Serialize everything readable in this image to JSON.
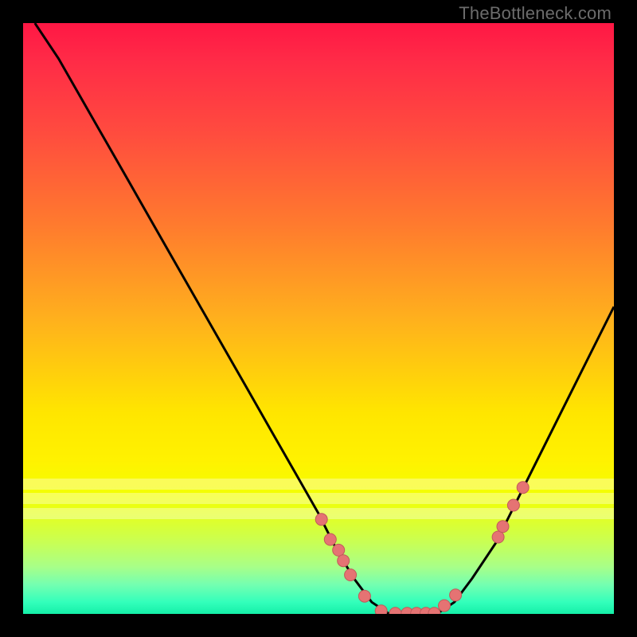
{
  "attribution": "TheBottleneck.com",
  "colors": {
    "frame": "#000000",
    "curve": "#000000",
    "marker_fill": "#e57373",
    "marker_stroke": "#c15a5a"
  },
  "chart_data": {
    "type": "line",
    "title": "",
    "xlabel": "",
    "ylabel": "",
    "xlim": [
      0,
      100
    ],
    "ylim": [
      0,
      100
    ],
    "series": [
      {
        "name": "bottleneck-curve",
        "x": [
          2,
          6,
          10,
          14,
          18,
          22,
          26,
          30,
          34,
          38,
          42,
          46,
          50,
          53,
          56,
          59,
          62,
          66,
          70,
          73,
          76,
          80,
          84,
          88,
          92,
          96,
          100
        ],
        "y": [
          100,
          94,
          87,
          80,
          73,
          66,
          59,
          52,
          45,
          38,
          31,
          24,
          17,
          11,
          6,
          2,
          0,
          0,
          0,
          2,
          6,
          12,
          20,
          28,
          36,
          44,
          52
        ]
      }
    ],
    "markers": {
      "name": "highlighted-points",
      "x": [
        50.5,
        52.0,
        53.4,
        54.2,
        55.4,
        57.8,
        60.6,
        63.0,
        65.0,
        66.6,
        68.2,
        69.6,
        71.3,
        73.2,
        80.4,
        81.2,
        83.0,
        84.6
      ],
      "y": [
        16.0,
        12.6,
        10.8,
        9.0,
        6.6,
        3.0,
        0.5,
        0.1,
        0.1,
        0.1,
        0.1,
        0.1,
        1.4,
        3.2,
        13.0,
        14.8,
        18.4,
        21.4
      ]
    },
    "wash_bands_y": [
      78,
      80.5,
      83
    ]
  }
}
